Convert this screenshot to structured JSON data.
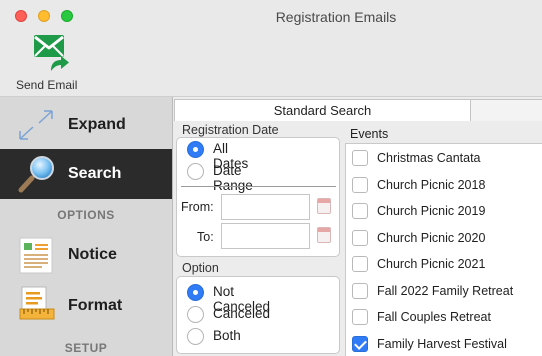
{
  "window": {
    "title": "Registration Emails"
  },
  "toolbar": {
    "send_label": "Send Email"
  },
  "sidebar": {
    "items": [
      {
        "label": "Expand"
      },
      {
        "label": "Search",
        "active": true
      },
      {
        "label": "Notice"
      },
      {
        "label": "Format"
      }
    ],
    "sections": [
      "OPTIONS",
      "SETUP"
    ]
  },
  "tabs": [
    {
      "label": "Standard Search",
      "selected": true
    }
  ],
  "registration_date": {
    "title": "Registration Date",
    "options": [
      {
        "label": "All Dates",
        "selected": true
      },
      {
        "label": "Date Range",
        "selected": false
      }
    ],
    "from_label": "From:",
    "to_label": "To:",
    "from_value": "",
    "to_value": ""
  },
  "option": {
    "title": "Option",
    "choices": [
      {
        "label": "Not Canceled",
        "selected": true
      },
      {
        "label": "Canceled",
        "selected": false
      },
      {
        "label": "Both",
        "selected": false
      }
    ]
  },
  "events": {
    "title": "Events",
    "items": [
      {
        "label": "Christmas Cantata",
        "checked": false
      },
      {
        "label": "Church Picnic 2018",
        "checked": false
      },
      {
        "label": "Church Picnic 2019",
        "checked": false
      },
      {
        "label": "Church Picnic 2020",
        "checked": false
      },
      {
        "label": "Church Picnic 2021",
        "checked": false
      },
      {
        "label": "Fall 2022 Family Retreat",
        "checked": false
      },
      {
        "label": "Fall Couples Retreat",
        "checked": false
      },
      {
        "label": "Family Harvest Festival",
        "checked": true
      }
    ]
  },
  "colors": {
    "accent": "#2f7cf6",
    "sidebar_active": "#2b2b2b",
    "send_icon": "#1f9a48"
  },
  "icons": [
    "send-email-icon",
    "expand-icon",
    "search-icon",
    "notice-icon",
    "format-icon",
    "calendar-icon"
  ]
}
